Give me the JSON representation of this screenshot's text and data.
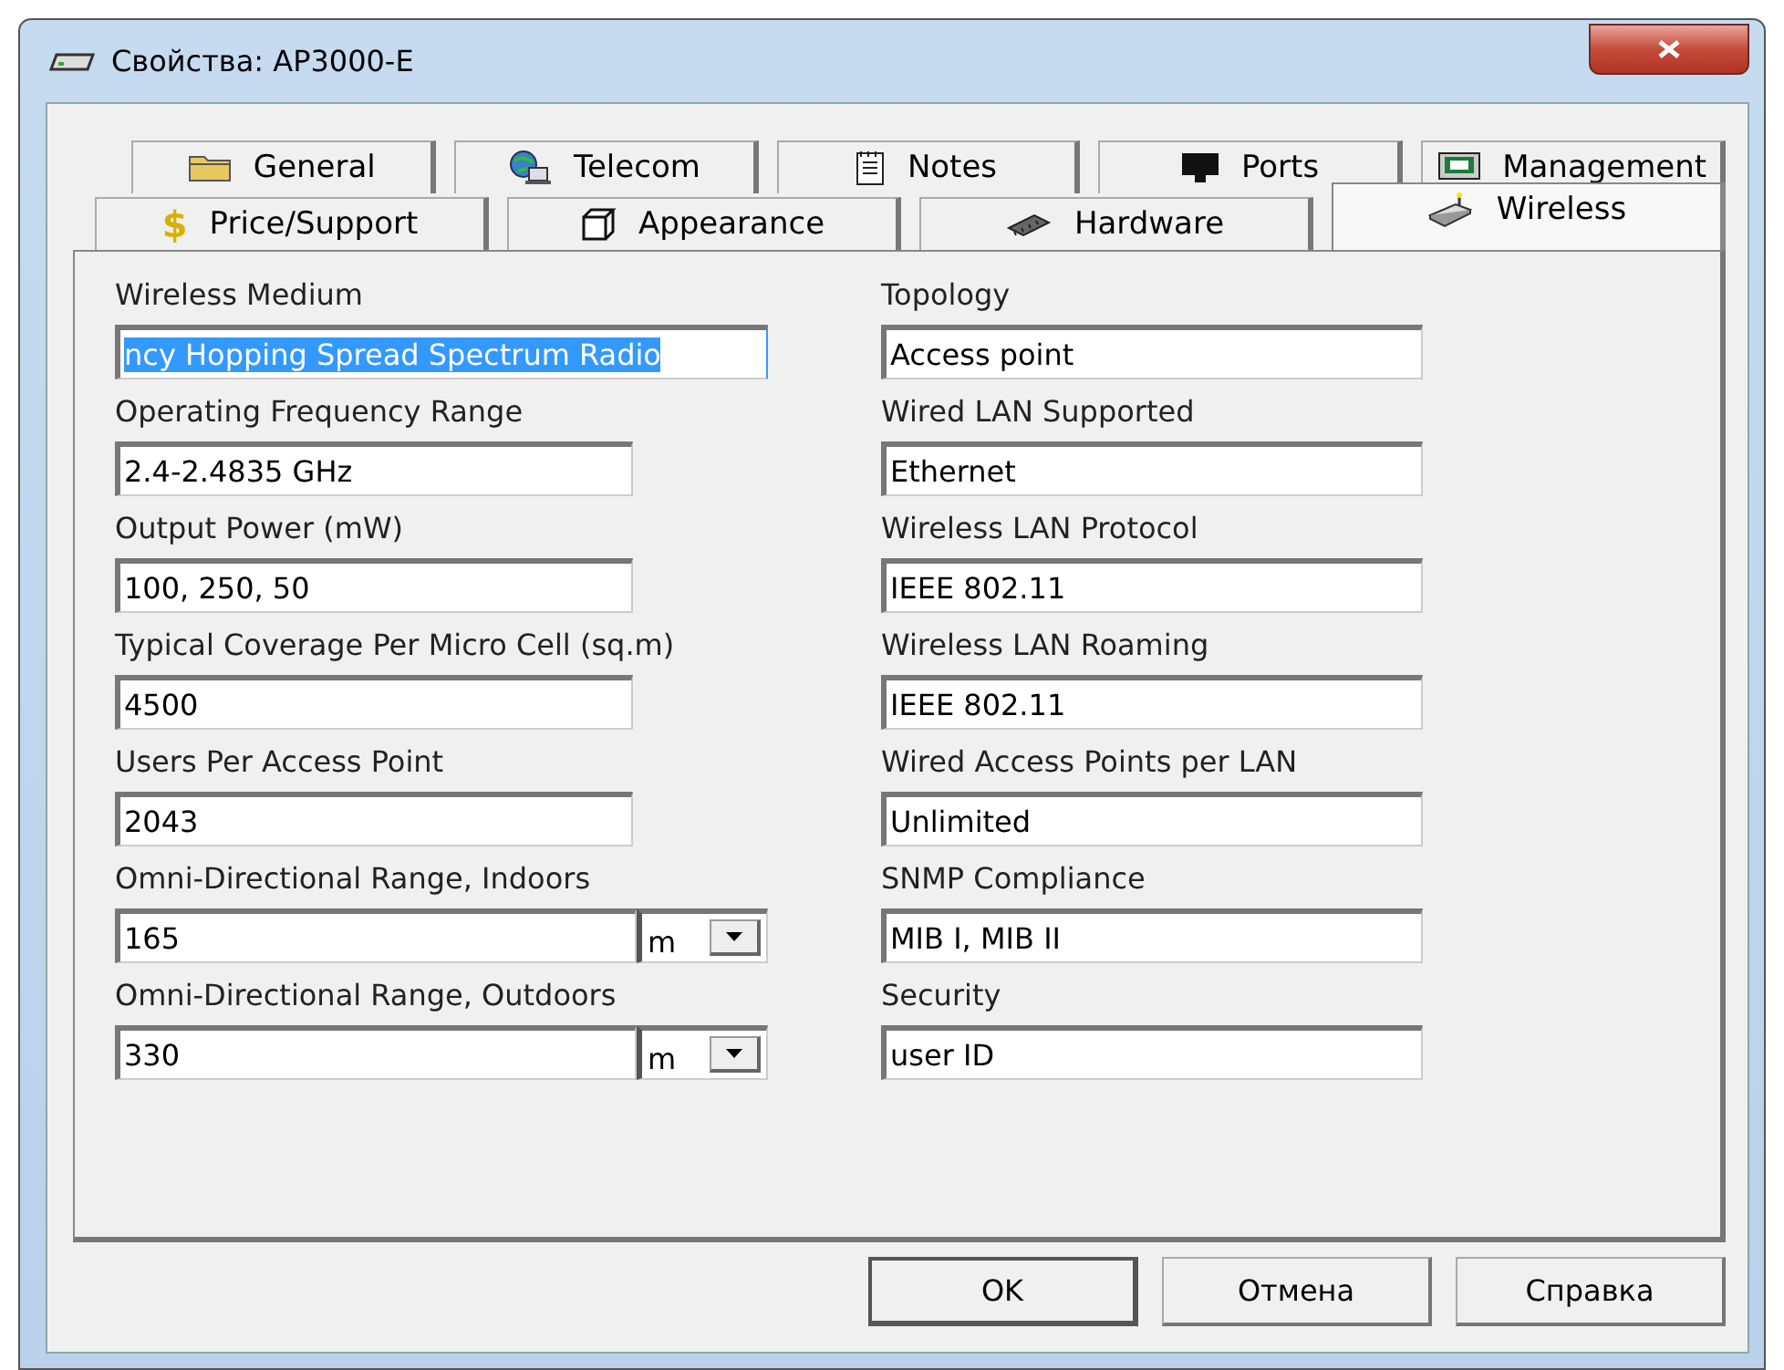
{
  "window": {
    "title": "Свойства: AP3000-E"
  },
  "tab_rows": [
    [
      {
        "label": "General",
        "selected": false
      },
      {
        "label": "Telecom",
        "selected": false
      },
      {
        "label": "Notes",
        "selected": false
      },
      {
        "label": "Ports",
        "selected": false
      },
      {
        "label": "Management",
        "selected": false
      }
    ],
    [
      {
        "label": "Price/Support",
        "symbol": "$",
        "selected": false
      },
      {
        "label": "Appearance",
        "selected": false
      },
      {
        "label": "Hardware",
        "selected": false
      },
      {
        "label": "Wireless",
        "selected": true
      }
    ]
  ],
  "left_fields": [
    {
      "kind": "wide_text",
      "label": "Wireless Medium",
      "value": "ncy Hopping Spread Spectrum Radio",
      "text_selected": true
    },
    {
      "kind": "text",
      "label": "Operating Frequency Range",
      "value": "2.4-2.4835 GHz"
    },
    {
      "kind": "text",
      "label": "Output Power (mW)",
      "value": "100, 250, 50"
    },
    {
      "kind": "text",
      "label": "Typical Coverage Per Micro Cell (sq.m)",
      "value": "4500"
    },
    {
      "kind": "text",
      "label": "Users Per Access Point",
      "value": "2043"
    },
    {
      "kind": "unit",
      "label": "Omni-Directional Range, Indoors",
      "value": "165",
      "unit": "m"
    },
    {
      "kind": "unit",
      "label": "Omni-Directional Range, Outdoors",
      "value": "330",
      "unit": "m"
    }
  ],
  "right_fields": [
    {
      "kind": "text",
      "label": "Topology",
      "value": "Access point"
    },
    {
      "kind": "text",
      "label": "Wired LAN Supported",
      "value": "Ethernet"
    },
    {
      "kind": "text",
      "label": "Wireless LAN Protocol",
      "value": "IEEE 802.11"
    },
    {
      "kind": "text",
      "label": "Wireless LAN Roaming",
      "value": "IEEE 802.11"
    },
    {
      "kind": "text",
      "label": "Wired Access Points per LAN",
      "value": "Unlimited"
    },
    {
      "kind": "text",
      "label": "SNMP Compliance",
      "value": "MIB I, MIB II"
    },
    {
      "kind": "text",
      "label": "Security",
      "value": "user ID"
    }
  ],
  "buttons": [
    {
      "label": "OK",
      "default": true
    },
    {
      "label": "Отмена",
      "default": false
    },
    {
      "label": "Справка",
      "default": false
    }
  ]
}
